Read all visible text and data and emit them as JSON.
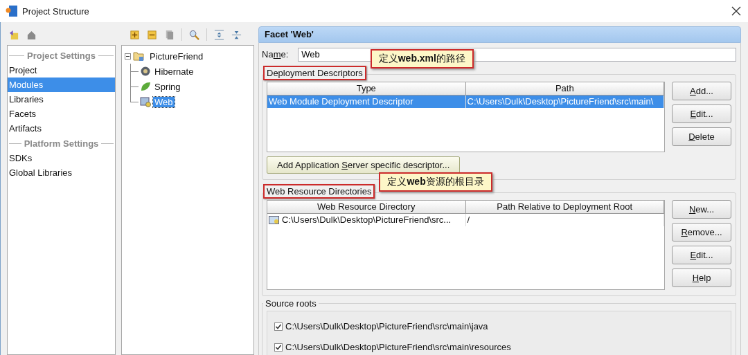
{
  "window": {
    "title": "Project Structure"
  },
  "sidebar": {
    "groups": [
      {
        "heading": "Project Settings",
        "items": [
          {
            "label": "Project",
            "selected": false
          },
          {
            "label": "Modules",
            "selected": true
          },
          {
            "label": "Libraries",
            "selected": false
          },
          {
            "label": "Facets",
            "selected": false
          },
          {
            "label": "Artifacts",
            "selected": false
          }
        ]
      },
      {
        "heading": "Platform Settings",
        "items": [
          {
            "label": "SDKs",
            "selected": false
          },
          {
            "label": "Global Libraries",
            "selected": false
          }
        ]
      }
    ]
  },
  "tree": {
    "root": {
      "label": "PictureFriend",
      "expanded": true,
      "selected": false,
      "children": [
        {
          "label": "Hibernate",
          "kind": "hibernate",
          "selected": false
        },
        {
          "label": "Spring",
          "kind": "spring",
          "selected": false
        },
        {
          "label": "Web",
          "kind": "web",
          "selected": true
        }
      ]
    }
  },
  "facet": {
    "title": "Facet 'Web'",
    "name_label": {
      "before": "Na",
      "key": "m",
      "after": "e:"
    },
    "name_value": "Web",
    "deployment_descriptors": {
      "legend": "Deployment Descriptors",
      "highlighted": true,
      "callout": "定义**web.xml**的路径",
      "columns": [
        "Type",
        "Path"
      ],
      "rows": [
        {
          "cells": [
            "Web Module Deployment Descriptor",
            "C:\\Users\\Dulk\\Desktop\\PictureFriend\\src\\main\\"
          ],
          "selected": true
        }
      ],
      "buttons": [
        {
          "key": "A",
          "after": "dd..."
        },
        {
          "key": "E",
          "after": "dit..."
        },
        {
          "key": "D",
          "after": "elete"
        }
      ],
      "extra_button": {
        "before": "Add Application ",
        "key": "S",
        "after": "erver specific descriptor..."
      }
    },
    "web_resource_directories": {
      "legend": "Web Resource Directories",
      "highlighted": true,
      "callout": "定义**web**资源的根目录",
      "columns": [
        "Web Resource Directory",
        "Path Relative to Deployment Root"
      ],
      "rows": [
        {
          "cells": [
            "C:\\Users\\Dulk\\Desktop\\PictureFriend\\src...",
            "/"
          ],
          "selected": false
        }
      ],
      "buttons": [
        {
          "key": "N",
          "after": "ew..."
        },
        {
          "key": "R",
          "after": "emove..."
        },
        {
          "key": "E",
          "after": "dit..."
        },
        {
          "key": "H",
          "after": "elp"
        }
      ]
    },
    "source_roots": {
      "legend": "Source roots",
      "items": [
        {
          "path": "C:\\Users\\Dulk\\Desktop\\PictureFriend\\src\\main\\java",
          "checked": true
        },
        {
          "path": "C:\\Users\\Dulk\\Desktop\\PictureFriend\\src\\main\\resources",
          "checked": true
        }
      ]
    }
  }
}
